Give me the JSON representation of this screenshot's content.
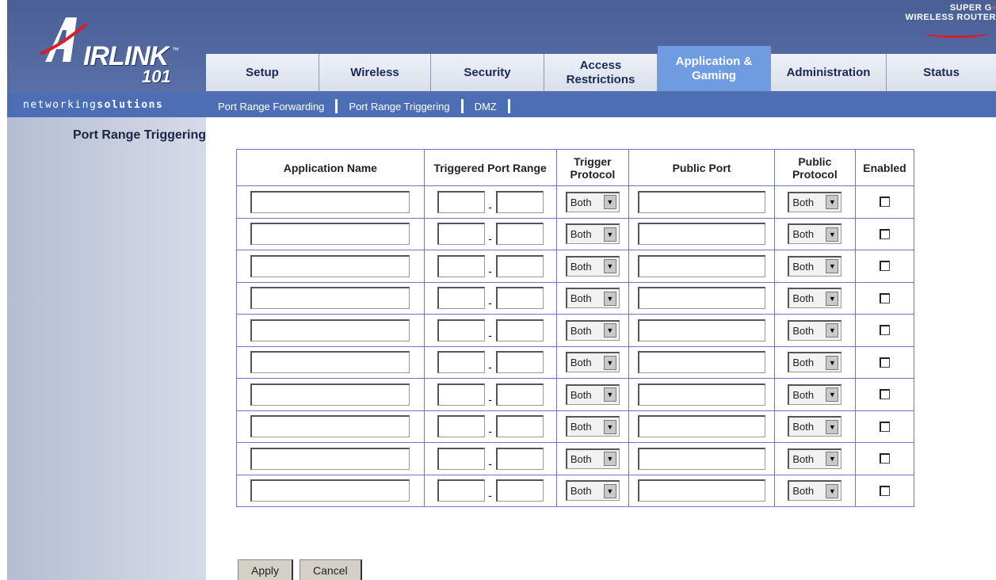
{
  "brand": {
    "logo_text": "IRLINK",
    "logo_number": "101",
    "trademark": "™",
    "tagline_normal": "networking",
    "tagline_bold": "solutions",
    "badge_line1": "SUPER G",
    "badge_sup": "+",
    "badge_line2": "WIRELESS ROUTER"
  },
  "tabs": [
    {
      "label": "Setup",
      "active": false
    },
    {
      "label": "Wireless",
      "active": false
    },
    {
      "label": "Security",
      "active": false
    },
    {
      "label": "Access Restrictions",
      "active": false
    },
    {
      "label": "Application & Gaming",
      "active": true
    },
    {
      "label": "Administration",
      "active": false
    },
    {
      "label": "Status",
      "active": false
    }
  ],
  "subnav": [
    {
      "label": "Port Range Forwarding"
    },
    {
      "label": "Port Range Triggering"
    },
    {
      "label": "DMZ"
    }
  ],
  "sidebar": {
    "title": "Port Range Triggering"
  },
  "table": {
    "headers": {
      "app_name": "Application Name",
      "triggered_range": "Triggered Port Range",
      "trigger_protocol": "Trigger Protocol",
      "public_port": "Public Port",
      "public_protocol": "Public Protocol",
      "enabled": "Enabled"
    },
    "rows": [
      {
        "app_name": "",
        "trig_start": "",
        "trig_end": "",
        "trig_protocol": "Both",
        "public_port": "",
        "pub_protocol": "Both",
        "enabled": false
      },
      {
        "app_name": "",
        "trig_start": "",
        "trig_end": "",
        "trig_protocol": "Both",
        "public_port": "",
        "pub_protocol": "Both",
        "enabled": false
      },
      {
        "app_name": "",
        "trig_start": "",
        "trig_end": "",
        "trig_protocol": "Both",
        "public_port": "",
        "pub_protocol": "Both",
        "enabled": false
      },
      {
        "app_name": "",
        "trig_start": "",
        "trig_end": "",
        "trig_protocol": "Both",
        "public_port": "",
        "pub_protocol": "Both",
        "enabled": false
      },
      {
        "app_name": "",
        "trig_start": "",
        "trig_end": "",
        "trig_protocol": "Both",
        "public_port": "",
        "pub_protocol": "Both",
        "enabled": false
      },
      {
        "app_name": "",
        "trig_start": "",
        "trig_end": "",
        "trig_protocol": "Both",
        "public_port": "",
        "pub_protocol": "Both",
        "enabled": false
      },
      {
        "app_name": "",
        "trig_start": "",
        "trig_end": "",
        "trig_protocol": "Both",
        "public_port": "",
        "pub_protocol": "Both",
        "enabled": false
      },
      {
        "app_name": "",
        "trig_start": "",
        "trig_end": "",
        "trig_protocol": "Both",
        "public_port": "",
        "pub_protocol": "Both",
        "enabled": false
      },
      {
        "app_name": "",
        "trig_start": "",
        "trig_end": "",
        "trig_protocol": "Both",
        "public_port": "",
        "pub_protocol": "Both",
        "enabled": false
      },
      {
        "app_name": "",
        "trig_start": "",
        "trig_end": "",
        "trig_protocol": "Both",
        "public_port": "",
        "pub_protocol": "Both",
        "enabled": false
      }
    ],
    "range_separator": "-"
  },
  "buttons": {
    "apply": "Apply",
    "cancel": "Cancel"
  },
  "colors": {
    "header": "#4a5f95",
    "subbar": "#4b6eb5",
    "active_tab": "#6f9be0",
    "table_border": "#6e76c2"
  }
}
